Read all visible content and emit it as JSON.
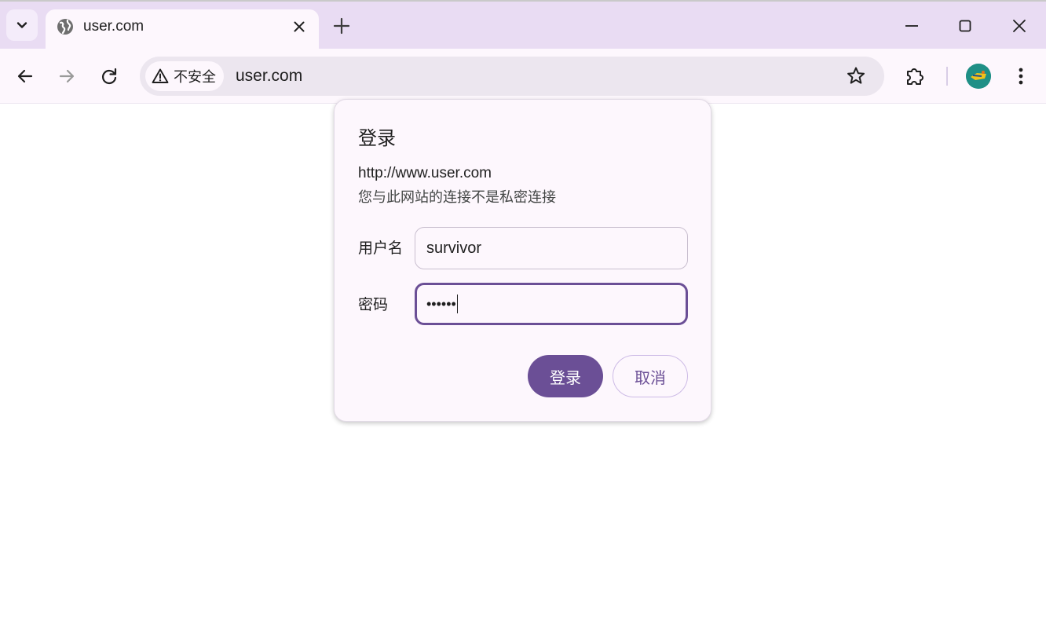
{
  "tab": {
    "title": "user.com",
    "icons": {
      "favicon": "globe-icon",
      "close": "close-icon",
      "new_tab": "plus-icon",
      "tab_search": "chevron-down-icon"
    }
  },
  "window_controls": {
    "icons": [
      "minimize-icon",
      "maximize-icon",
      "close-icon"
    ]
  },
  "toolbar": {
    "security_label": "不安全",
    "url": "user.com",
    "icons": [
      "back-arrow-icon",
      "forward-arrow-icon",
      "reload-icon",
      "warning-icon",
      "star-icon",
      "extensions-icon",
      "avatar",
      "more-vert-icon"
    ]
  },
  "dialog": {
    "title": "登录",
    "origin": "http://www.user.com",
    "warning": "您与此网站的连接不是私密连接",
    "username_label": "用户名",
    "username_value": "survivor",
    "password_label": "密码",
    "password_masked": "••••••",
    "login_button": "登录",
    "cancel_button": "取消"
  },
  "colors": {
    "accent": "#6b4f96",
    "tabstrip_bg": "#e9dcf3",
    "toolbar_bg": "#fdf7fd",
    "omnibox_bg": "#ece6ef"
  }
}
